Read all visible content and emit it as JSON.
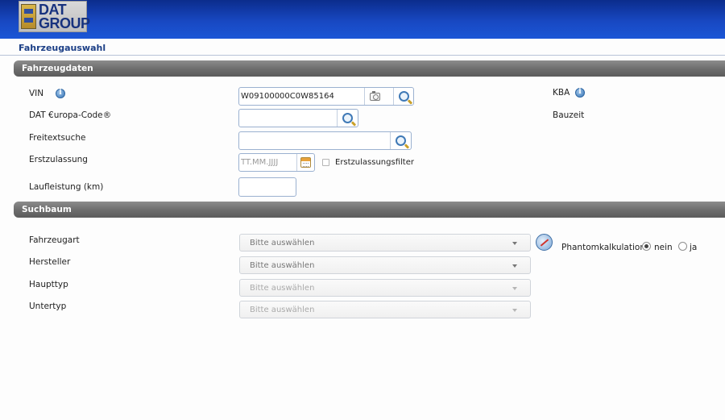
{
  "header": {
    "logo_line1": "DAT",
    "logo_line2": "GROUP",
    "colors": {
      "bar_top": "#0b2c8c",
      "bar_bottom": "#1b56d6"
    }
  },
  "page": {
    "title": "Fahrzeugauswahl"
  },
  "sections": {
    "fahrzeugdaten": "Fahrzeugdaten",
    "suchbaum": "Suchbaum"
  },
  "fields": {
    "vin": {
      "label": "VIN",
      "value": "W09100000C0W85164"
    },
    "europa_code": {
      "label": "DAT €uropa-Code®",
      "value": ""
    },
    "freitextsuche": {
      "label": "Freitextsuche",
      "value": ""
    },
    "erstzulassung": {
      "label": "Erstzulassung",
      "value": "",
      "placeholder": "TT.MM.JJJJ",
      "filter_label": "Erstzulassungsfilter",
      "filter_checked": false
    },
    "laufleistung": {
      "label": "Laufleistung (km)",
      "value": ""
    },
    "kba": {
      "label": "KBA"
    },
    "bauzeit": {
      "label": "Bauzeit"
    }
  },
  "suchbaum": {
    "fahrzeugart": {
      "label": "Fahrzeugart",
      "value": "Bitte auswählen",
      "enabled": true
    },
    "hersteller": {
      "label": "Hersteller",
      "value": "Bitte auswählen",
      "enabled": true
    },
    "haupttyp": {
      "label": "Haupttyp",
      "value": "Bitte auswählen",
      "enabled": false
    },
    "untertyp": {
      "label": "Untertyp",
      "value": "Bitte auswählen",
      "enabled": false
    }
  },
  "phantom": {
    "label": "Phantomkalkulation",
    "options": [
      "nein",
      "ja"
    ],
    "selected": "nein"
  },
  "icons": [
    "info-icon",
    "camera-icon",
    "search-icon",
    "calendar-icon",
    "compass-icon",
    "chevron-down-icon"
  ]
}
